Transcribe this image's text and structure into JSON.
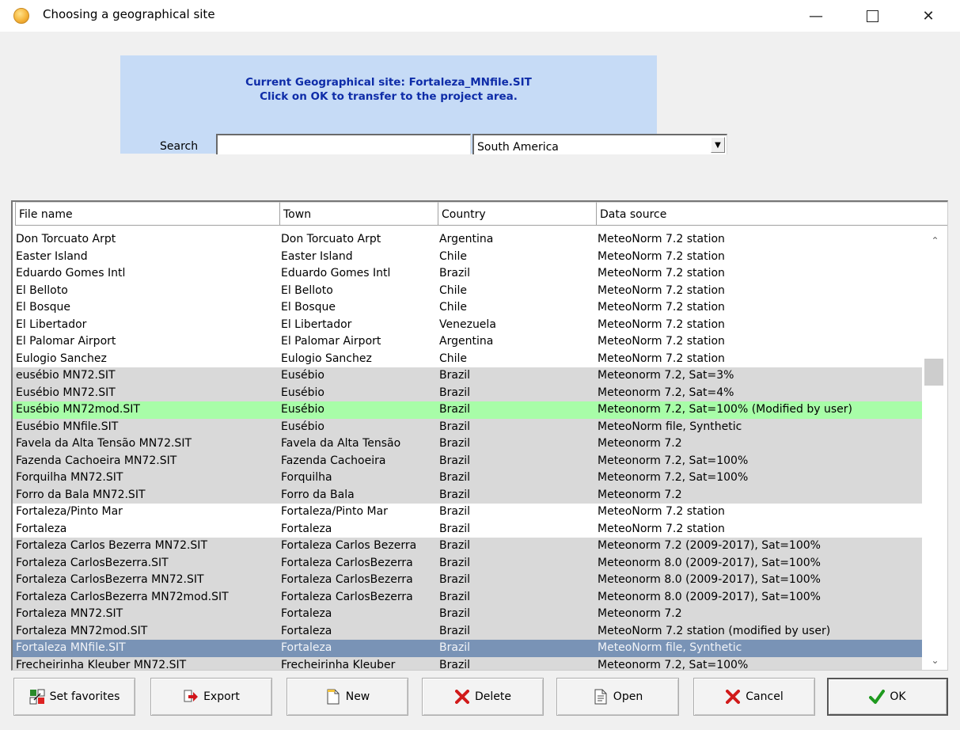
{
  "window": {
    "title": "Choosing a geographical site"
  },
  "info": {
    "line1": "Current Geographical site: Fortaleza_MNfile.SIT",
    "line2": "Click on OK to transfer to the project area."
  },
  "search": {
    "label": "Search",
    "value": "",
    "region_selected": "South America"
  },
  "list": {
    "columns": [
      "File name",
      "Town",
      "Country",
      "Data source"
    ],
    "rows": [
      {
        "style": "white",
        "file": "Don Torcuato Arpt",
        "town": "Don Torcuato Arpt",
        "country": "Argentina",
        "source": "MeteoNorm 7.2 station"
      },
      {
        "style": "white",
        "file": "Easter Island",
        "town": "Easter Island",
        "country": "Chile",
        "source": "MeteoNorm 7.2 station"
      },
      {
        "style": "white",
        "file": "Eduardo Gomes Intl",
        "town": "Eduardo Gomes Intl",
        "country": "Brazil",
        "source": "MeteoNorm 7.2 station"
      },
      {
        "style": "white",
        "file": "El Belloto",
        "town": "El Belloto",
        "country": "Chile",
        "source": "MeteoNorm 7.2 station"
      },
      {
        "style": "white",
        "file": "El Bosque",
        "town": "El Bosque",
        "country": "Chile",
        "source": "MeteoNorm 7.2 station"
      },
      {
        "style": "white",
        "file": "El Libertador",
        "town": "El Libertador",
        "country": "Venezuela",
        "source": "MeteoNorm 7.2 station"
      },
      {
        "style": "white",
        "file": "El Palomar Airport",
        "town": "El Palomar Airport",
        "country": "Argentina",
        "source": "MeteoNorm 7.2 station"
      },
      {
        "style": "white",
        "file": "Eulogio Sanchez",
        "town": "Eulogio Sanchez",
        "country": "Chile",
        "source": "MeteoNorm 7.2 station"
      },
      {
        "style": "gray",
        "file": "eusébio MN72.SIT",
        "town": "Eusébio",
        "country": "Brazil",
        "source": "Meteonorm 7.2, Sat=3%"
      },
      {
        "style": "gray",
        "file": "Eusébio MN72.SIT",
        "town": "Eusébio",
        "country": "Brazil",
        "source": "Meteonorm 7.2, Sat=4%"
      },
      {
        "style": "green",
        "file": "Eusébio MN72mod.SIT",
        "town": "Eusébio",
        "country": "Brazil",
        "source": "Meteonorm 7.2, Sat=100% (Modified by user)"
      },
      {
        "style": "gray",
        "file": "Eusébio MNfile.SIT",
        "town": "Eusébio",
        "country": "Brazil",
        "source": "MeteoNorm file, Synthetic"
      },
      {
        "style": "gray",
        "file": "Favela da Alta Tensão MN72.SIT",
        "town": "Favela da Alta Tensão",
        "country": "Brazil",
        "source": "Meteonorm 7.2"
      },
      {
        "style": "gray",
        "file": "Fazenda Cachoeira MN72.SIT",
        "town": "Fazenda Cachoeira",
        "country": "Brazil",
        "source": "Meteonorm 7.2, Sat=100%"
      },
      {
        "style": "gray",
        "file": "Forquilha MN72.SIT",
        "town": "Forquilha",
        "country": "Brazil",
        "source": "Meteonorm 7.2, Sat=100%"
      },
      {
        "style": "gray",
        "file": "Forro da Bala MN72.SIT",
        "town": "Forro da Bala",
        "country": "Brazil",
        "source": "Meteonorm 7.2"
      },
      {
        "style": "white",
        "file": "Fortaleza/Pinto Mar",
        "town": "Fortaleza/Pinto Mar",
        "country": "Brazil",
        "source": "MeteoNorm 7.2 station"
      },
      {
        "style": "white",
        "file": "Fortaleza",
        "town": "Fortaleza",
        "country": "Brazil",
        "source": "MeteoNorm 7.2 station"
      },
      {
        "style": "gray",
        "file": "Fortaleza Carlos Bezerra MN72.SIT",
        "town": "Fortaleza Carlos Bezerra",
        "country": "Brazil",
        "source": "Meteonorm 7.2 (2009-2017), Sat=100%"
      },
      {
        "style": "gray",
        "file": "Fortaleza CarlosBezerra.SIT",
        "town": "Fortaleza CarlosBezerra",
        "country": "Brazil",
        "source": "Meteonorm 8.0 (2009-2017), Sat=100%"
      },
      {
        "style": "gray",
        "file": "Fortaleza CarlosBezerra MN72.SIT",
        "town": "Fortaleza CarlosBezerra",
        "country": "Brazil",
        "source": "Meteonorm 8.0 (2009-2017), Sat=100%"
      },
      {
        "style": "gray",
        "file": "Fortaleza CarlosBezerra MN72mod.SIT",
        "town": "Fortaleza CarlosBezerra",
        "country": "Brazil",
        "source": "Meteonorm 8.0 (2009-2017), Sat=100%"
      },
      {
        "style": "gray",
        "file": "Fortaleza MN72.SIT",
        "town": "Fortaleza",
        "country": "Brazil",
        "source": "Meteonorm 7.2"
      },
      {
        "style": "gray",
        "file": "Fortaleza MN72mod.SIT",
        "town": "Fortaleza",
        "country": "Brazil",
        "source": "MeteoNorm 7.2 station (modified by user)"
      },
      {
        "style": "selected",
        "file": "Fortaleza MNfile.SIT",
        "town": "Fortaleza",
        "country": "Brazil",
        "source": "MeteoNorm file, Synthetic"
      },
      {
        "style": "gray",
        "file": "Frecheirinha Kleuber MN72.SIT",
        "town": "Frecheirinha Kleuber",
        "country": "Brazil",
        "source": "Meteonorm 7.2, Sat=100%"
      }
    ]
  },
  "buttons": {
    "favorites": "Set favorites",
    "export": "Export",
    "new": "New",
    "delete": "Delete",
    "open": "Open",
    "cancel": "Cancel",
    "ok": "OK"
  },
  "icons": {
    "app": "sun-icon",
    "favorites": "favorites-icon",
    "export": "export-arrow-icon",
    "new": "new-document-icon",
    "delete": "delete-x-icon",
    "open": "open-document-icon",
    "cancel": "cancel-x-icon",
    "ok": "checkmark-icon"
  },
  "colors": {
    "info_panel_bg": "#c6dbf6",
    "info_text": "#0e2ca8",
    "row_gray": "#d9d9d9",
    "row_green": "#a8fda8",
    "row_selected": "#7993b6",
    "delete_red": "#d11a1a",
    "ok_green": "#1f9a1f"
  }
}
